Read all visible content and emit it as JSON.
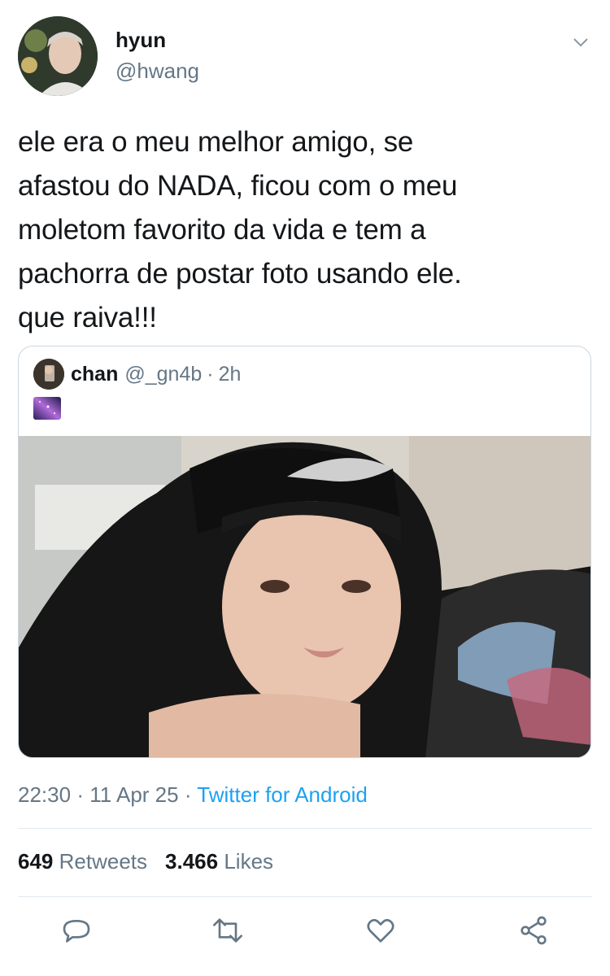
{
  "author": {
    "display_name": "hyun",
    "handle": "@hwang",
    "avatar_icon": "profile-photo"
  },
  "tweet": {
    "text": "ele era o meu melhor amigo, se\nafastou do NADA, ficou com o meu\nmoletom favorito da vida e tem a\npachorra de postar foto usando ele.\nque raiva!!!"
  },
  "quoted": {
    "name": "chan",
    "handle": "@_gn4b",
    "separator": "·",
    "age": "2h",
    "emoji_icon": "milky-way-emoji"
  },
  "meta": {
    "time": "22:30",
    "sep1": "·",
    "date": "11 Apr 25",
    "sep2": "·",
    "source": "Twitter for Android"
  },
  "stats": {
    "retweets_count": "649",
    "retweets_label": "Retweets",
    "likes_count": "3.466",
    "likes_label": "Likes"
  },
  "actions": [
    "reply-icon",
    "retweet-icon",
    "like-icon",
    "share-icon"
  ],
  "colors": {
    "text": "#14171a",
    "secondary": "#657786",
    "accent": "#1da1f2",
    "border": "#ccd6dd"
  }
}
